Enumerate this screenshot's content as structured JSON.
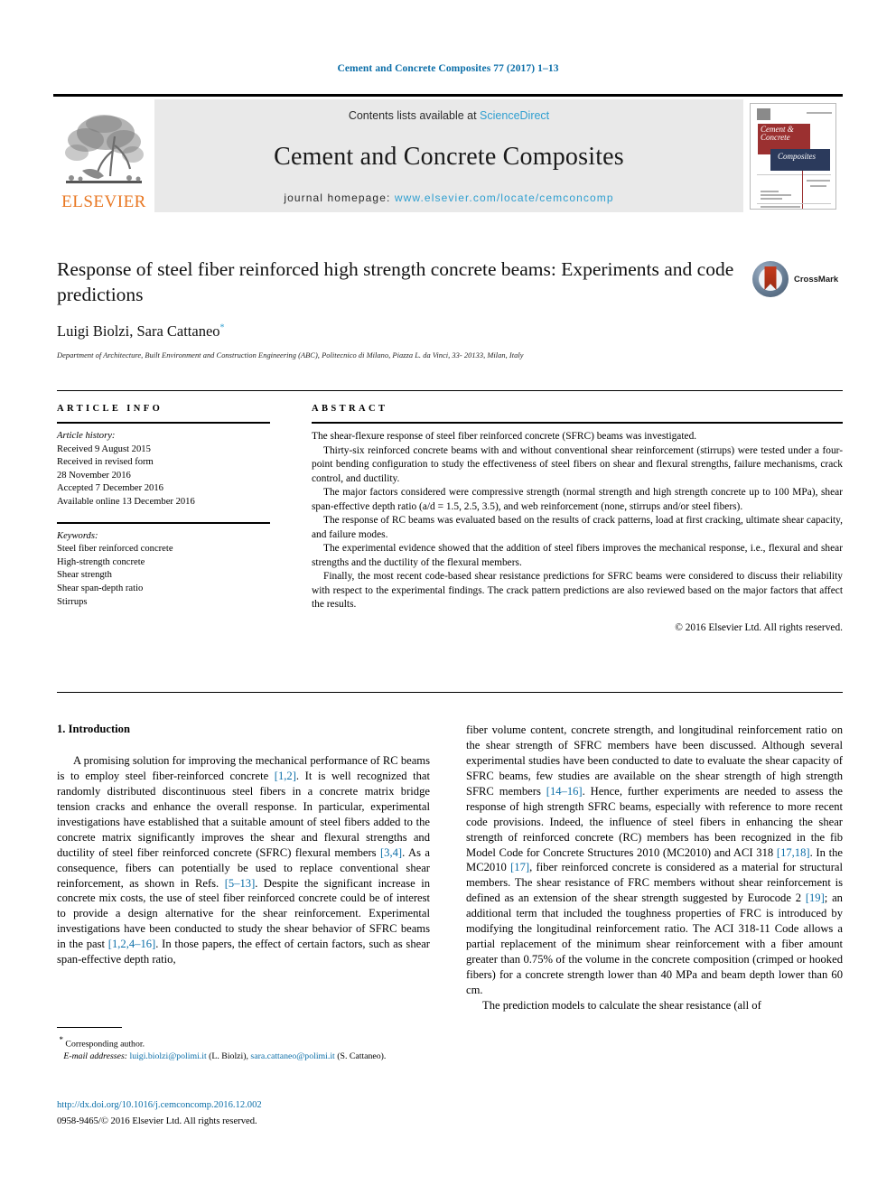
{
  "running_head": "Cement and Concrete Composites 77 (2017) 1–13",
  "masthead": {
    "publisher_name": "ELSEVIER",
    "publisher_logo_icon": "elsevier-tree-icon",
    "contents_prefix": "Contents lists available at ",
    "contents_link": "ScienceDirect",
    "journal_title": "Cement and Concrete Composites",
    "homepage_prefix": "journal homepage: ",
    "homepage_url": "www.elsevier.com/locate/cemconcomp",
    "cover": {
      "line1": "Cement &",
      "line2": "Concrete",
      "line3": "Composites"
    }
  },
  "article": {
    "title": "Response of steel fiber reinforced high strength concrete beams: Experiments and code predictions",
    "authors": "Luigi Biolzi, Sara Cattaneo",
    "corresponding_marker": "*",
    "affiliation": "Department of Architecture, Built Environment and Construction Engineering (ABC), Politecnico di Milano, Piazza L. da Vinci, 33- 20133, Milan, Italy",
    "crossmark_label": "CrossMark",
    "crossmark_icon": "crossmark-icon"
  },
  "article_info": {
    "heading": "ARTICLE INFO",
    "history_label": "Article history:",
    "history": [
      "Received 9 August 2015",
      "Received in revised form",
      "28 November 2016",
      "Accepted 7 December 2016",
      "Available online 13 December 2016"
    ],
    "keywords_label": "Keywords:",
    "keywords": [
      "Steel fiber reinforced concrete",
      "High-strength concrete",
      "Shear strength",
      "Shear span-depth ratio",
      "Stirrups"
    ]
  },
  "abstract": {
    "heading": "ABSTRACT",
    "paragraphs": [
      "The shear-flexure response of steel fiber reinforced concrete (SFRC) beams was investigated.",
      "Thirty-six reinforced concrete beams with and without conventional shear reinforcement (stirrups) were tested under a four-point bending configuration to study the effectiveness of steel fibers on shear and flexural strengths, failure mechanisms, crack control, and ductility.",
      "The major factors considered were compressive strength (normal strength and high strength concrete up to 100 MPa), shear span-effective depth ratio (a/d = 1.5, 2.5, 3.5), and web reinforcement (none, stirrups and/or steel fibers).",
      "The response of RC beams was evaluated based on the results of crack patterns, load at first cracking, ultimate shear capacity, and failure modes.",
      "The experimental evidence showed that the addition of steel fibers improves the mechanical response, i.e., flexural and shear strengths and the ductility of the flexural members.",
      "Finally, the most recent code-based shear resistance predictions for SFRC beams were considered to discuss their reliability with respect to the experimental findings. The crack pattern predictions are also reviewed based on the major factors that affect the results."
    ],
    "copyright": "© 2016 Elsevier Ltd. All rights reserved."
  },
  "body": {
    "section_heading": "1. Introduction",
    "left_paragraph_html": "A promising solution for improving the mechanical performance of RC beams is to employ steel fiber-reinforced concrete <span class=\"ref\">[1,2]</span>. It is well recognized that randomly distributed discontinuous steel fibers in a concrete matrix bridge tension cracks and enhance the overall response. In particular, experimental investigations have established that a suitable amount of steel fibers added to the concrete matrix significantly improves the shear and flexural strengths and ductility of steel fiber reinforced concrete (SFRC) flexural members <span class=\"ref\">[3,4]</span>. As a consequence, fibers can potentially be used to replace conventional shear reinforcement, as shown in Refs. <span class=\"ref\">[5–13]</span>. Despite the significant increase in concrete mix costs, the use of steel fiber reinforced concrete could be of interest to provide a design alternative for the shear reinforcement. Experimental investigations have been conducted to study the shear behavior of SFRC beams in the past <span class=\"ref\">[1,2,4–16]</span>. In those papers, the effect of certain factors, such as shear span-effective depth ratio,",
    "right_paragraph1_html": "fiber volume content, concrete strength, and longitudinal reinforcement ratio on the shear strength of SFRC members have been discussed. Although several experimental studies have been conducted to date to evaluate the shear capacity of SFRC beams, few studies are available on the shear strength of high strength SFRC members <span class=\"ref\">[14–16]</span>. Hence, further experiments are needed to assess the response of high strength SFRC beams, especially with reference to more recent code provisions. Indeed, the influence of steel fibers in enhancing the shear strength of reinforced concrete (RC) members has been recognized in the fib Model Code for Concrete Structures 2010 (MC2010) and ACI 318 <span class=\"ref\">[17,18]</span>. In the MC2010 <span class=\"ref\">[17]</span>, fiber reinforced concrete is considered as a material for structural members. The shear resistance of FRC members without shear reinforcement is defined as an extension of the shear strength suggested by Eurocode 2 <span class=\"ref\">[19]</span>; an additional term that included the toughness properties of FRC is introduced by modifying the longitudinal reinforcement ratio. The ACI 318-11 Code allows a partial replacement of the minimum shear reinforcement with a fiber amount greater than 0.75% of the volume in the concrete composition (crimped or hooked fibers) for a concrete strength lower than 40 MPa and beam depth lower than 60 cm.",
    "right_paragraph2_html": "The prediction models to calculate the shear resistance (all of"
  },
  "footnote": {
    "corresponding": "Corresponding author.",
    "corresponding_marker": "*",
    "email_label": "E-mail addresses:",
    "email1": "luigi.biolzi@polimi.it",
    "email1_owner": "(L. Biolzi),",
    "email2": "sara.cattaneo@polimi.it",
    "email2_owner": "(S. Cattaneo)."
  },
  "footer": {
    "doi": "http://dx.doi.org/10.1016/j.cemconcomp.2016.12.002",
    "issn_copyright": "0958-9465/© 2016 Elsevier Ltd. All rights reserved."
  },
  "colors": {
    "link_blue": "#0b6ea8",
    "sciencedirect_blue": "#2f9fd0",
    "elsevier_orange": "#E87722",
    "band_gray": "#e9e9e9"
  }
}
